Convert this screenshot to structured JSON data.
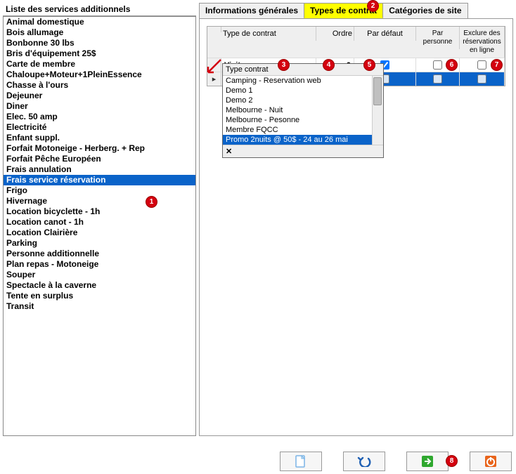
{
  "left": {
    "title": "Liste des services additionnels",
    "items": [
      "Animal domestique",
      "Bois allumage",
      "Bonbonne 30 lbs",
      "Bris d'équipement 25$",
      "Carte de membre",
      "Chaloupe+Moteur+1PleinEssence",
      "Chasse à l'ours",
      "Dejeuner",
      "Diner",
      "Elec. 50 amp",
      "Electricité",
      "Enfant suppl.",
      "Forfait Motoneige - Herberg. + Rep",
      "Forfait Pêche Européen",
      "Frais annulation",
      "Frais service réservation",
      "Frigo",
      "Hivernage",
      "Location bicyclette - 1h",
      "Location canot - 1h",
      "Location Clairière",
      "Parking",
      "Personne additionnelle",
      "Plan repas - Motoneige",
      "Souper",
      "Spectacle à la caverne",
      "Tente en surplus",
      "Transit"
    ],
    "selectedIndex": 15
  },
  "tabs": {
    "t0": "Informations générales",
    "t1": "Types de contrat",
    "t2": "Catégories de site",
    "activeIndex": 1
  },
  "grid": {
    "headers": {
      "type": "Type de contrat",
      "ordre": "Ordre",
      "def": "Par défaut",
      "pers": "Par personne",
      "excl": "Exclure des réservations en ligne"
    },
    "rows": [
      {
        "type": "Visiteurs",
        "ordre": "0",
        "def": true,
        "pers": false,
        "excl": false
      }
    ]
  },
  "dropdown": {
    "header": "Type contrat",
    "options": [
      "Camping - Reservation web",
      "Demo 1",
      "Demo 2",
      "Melbourne - Nuit",
      "Melbourne - Pesonne",
      "Membre FQCC",
      "Promo 2nuits @ 50$ - 24 au 26 mai"
    ],
    "selectedIndex": 6,
    "closeSymbol": "✕"
  },
  "callouts": {
    "c1": "1",
    "c2": "2",
    "c3": "3",
    "c4": "4",
    "c5": "5",
    "c6": "6",
    "c7": "7",
    "c8": "8"
  }
}
